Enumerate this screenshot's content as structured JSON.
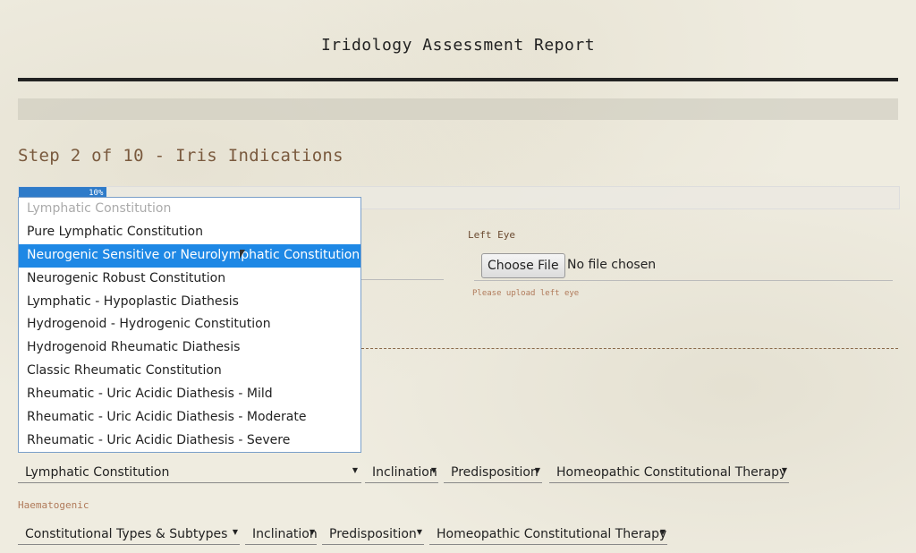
{
  "header": {
    "title": "Iridology Assessment Report"
  },
  "step": {
    "heading": "Step 2 of 10 - Iris Indications",
    "progress_label": "10%",
    "progress_fraction": 0.1
  },
  "left_eye": {
    "label": "Left Eye",
    "choose_file_label": "Choose File",
    "no_file_text": "No file chosen",
    "hint": "Please upload left eye"
  },
  "constitution_dropdown": {
    "options": [
      "Lymphatic Constitution",
      "Pure Lymphatic Constitution",
      "Neurogenic Sensitive or Neurolymphatic Constitution",
      "Neurogenic Robust Constitution",
      "Lymphatic - Hypoplastic Diathesis",
      "Hydrogenoid - Hydrogenic Constitution",
      "Hydrogenoid Rheumatic Diathesis",
      "Classic Rheumatic Constitution",
      "Rheumatic - Uric Acidic Diathesis - Mild",
      "Rheumatic - Uric Acidic Diathesis - Moderate",
      "Rheumatic - Uric Acidic Diathesis - Severe"
    ],
    "disabled_index": 0,
    "highlighted_index": 2
  },
  "lymphatic_row": {
    "constitution_value": "Lymphatic Constitution",
    "inclination": "Inclination",
    "predisposition": "Predisposition",
    "therapy": "Homeopathic Constitutional Therapy"
  },
  "haematogenic": {
    "section_label": "Haematogenic",
    "types": "Constitutional Types & Subtypes",
    "inclination": "Inclination",
    "predisposition": "Predisposition",
    "therapy": "Homeopathic Constitutional Therapy"
  },
  "colors": {
    "accent": "#1e88e5",
    "progress": "#2e7bc9",
    "heading": "#7a5a3e",
    "hint": "#b07a5a"
  }
}
